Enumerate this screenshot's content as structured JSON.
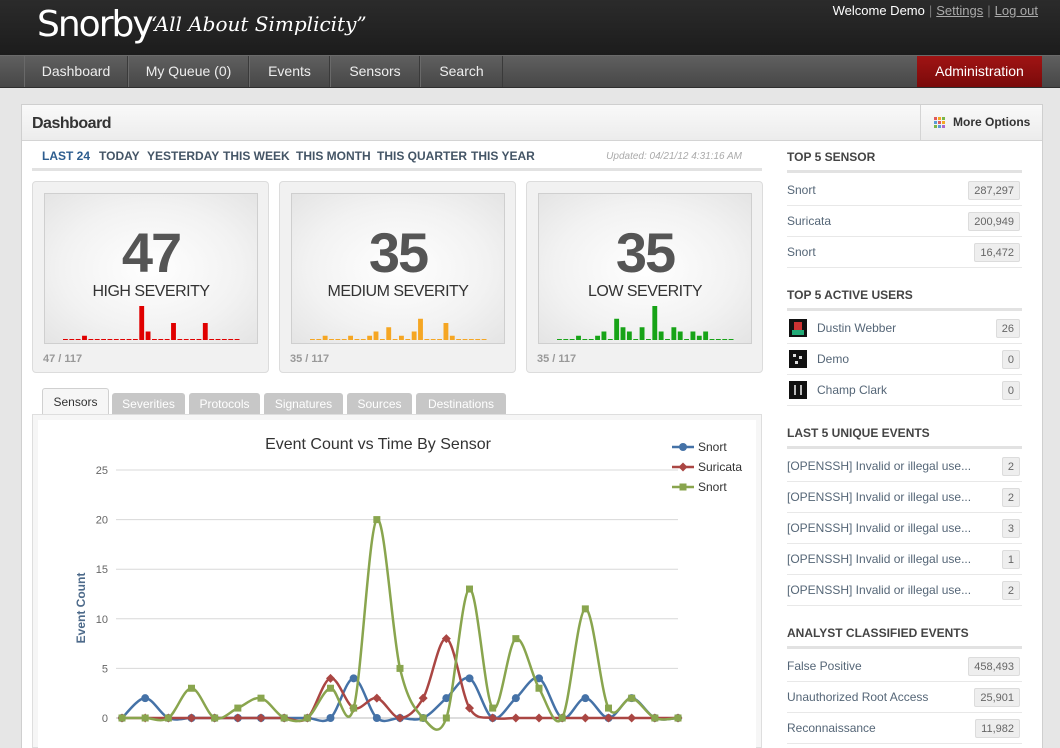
{
  "header": {
    "logo": "Snorby",
    "tagline": "“All About Simplicity”",
    "welcome": "Welcome Demo",
    "settings_link": "Settings",
    "logout_link": "Log out"
  },
  "nav": {
    "items": [
      "Dashboard",
      "My Queue (0)",
      "Events",
      "Sensors",
      "Search"
    ],
    "admin": "Administration"
  },
  "panel": {
    "title": "Dashboard",
    "more_options": "More Options"
  },
  "time_filters": [
    "LAST 24",
    "TODAY",
    "YESTERDAY",
    "THIS WEEK",
    "THIS MONTH",
    "THIS QUARTER",
    "THIS YEAR"
  ],
  "updated": "Updated: 04/21/12 4:31:16 AM",
  "severity": [
    {
      "count": "47",
      "label": "HIGH SEVERITY",
      "footer": "47 / 117",
      "color": "#e00000",
      "bars": [
        0,
        0,
        0,
        1,
        0,
        0,
        0,
        0,
        0,
        0,
        0,
        0,
        8,
        2,
        0,
        0,
        0,
        4,
        0,
        0,
        0,
        0,
        4,
        0,
        0,
        0,
        0,
        0
      ]
    },
    {
      "count": "35",
      "label": "MEDIUM SEVERITY",
      "footer": "35 / 117",
      "color": "#f5a623",
      "bars": [
        0,
        0,
        1,
        0,
        0,
        0,
        1,
        0,
        0,
        1,
        2,
        0,
        3,
        0,
        1,
        0,
        2,
        5,
        0,
        0,
        0,
        4,
        1,
        0,
        0,
        0,
        0,
        0
      ]
    },
    {
      "count": "35",
      "label": "LOW SEVERITY",
      "footer": "35 / 117",
      "color": "#17a317",
      "bars": [
        0,
        0,
        0,
        1,
        0,
        0,
        1,
        2,
        0,
        5,
        3,
        2,
        0,
        3,
        0,
        8,
        2,
        0,
        3,
        2,
        0,
        2,
        1,
        2,
        0,
        0,
        0,
        0
      ]
    }
  ],
  "tabs": [
    "Sensors",
    "Severities",
    "Protocols",
    "Signatures",
    "Sources",
    "Destinations"
  ],
  "sidebar": {
    "top_sensor_title": "TOP 5 SENSOR",
    "top_sensors": [
      {
        "name": "Snort",
        "count": "287,297"
      },
      {
        "name": "Suricata",
        "count": "200,949"
      },
      {
        "name": "Snort",
        "count": "16,472"
      }
    ],
    "active_users_title": "TOP 5 ACTIVE USERS",
    "active_users": [
      {
        "name": "Dustin Webber",
        "count": "26"
      },
      {
        "name": "Demo",
        "count": "0"
      },
      {
        "name": "Champ Clark",
        "count": "0"
      }
    ],
    "unique_events_title": "LAST 5 UNIQUE EVENTS",
    "unique_events": [
      {
        "name": "[OPENSSH] Invalid or illegal use...",
        "count": "2"
      },
      {
        "name": "[OPENSSH] Invalid or illegal use...",
        "count": "2"
      },
      {
        "name": "[OPENSSH] Invalid or illegal use...",
        "count": "3"
      },
      {
        "name": "[OPENSSH] Invalid or illegal use...",
        "count": "1"
      },
      {
        "name": "[OPENSSH] Invalid or illegal use...",
        "count": "2"
      }
    ],
    "classified_title": "ANALYST CLASSIFIED EVENTS",
    "classified": [
      {
        "name": "False Positive",
        "count": "458,493"
      },
      {
        "name": "Unauthorized Root Access",
        "count": "25,901"
      },
      {
        "name": "Reconnaissance",
        "count": "11,982"
      }
    ]
  },
  "chart_data": {
    "type": "line",
    "title": "Event Count vs Time By Sensor",
    "ylabel": "Event Count",
    "xlabel": "",
    "ylim": [
      0,
      25
    ],
    "yticks": [
      0,
      5,
      10,
      15,
      20,
      25
    ],
    "grid": true,
    "legend": "top-right",
    "series": [
      {
        "name": "Snort",
        "color": "#4572a7",
        "marker": "circle",
        "values": [
          0,
          2,
          0,
          0,
          0,
          0,
          0,
          0,
          0,
          0,
          4,
          0,
          0,
          0,
          2,
          4,
          0,
          2,
          4,
          0,
          2,
          0,
          2,
          0,
          0
        ]
      },
      {
        "name": "Suricata",
        "color": "#aa4643",
        "marker": "diamond",
        "values": [
          0,
          0,
          0,
          0,
          0,
          0,
          0,
          0,
          0,
          4,
          1,
          2,
          0,
          2,
          8,
          1,
          0,
          0,
          0,
          0,
          0,
          0,
          0,
          0,
          0
        ]
      },
      {
        "name": "Snort",
        "color": "#89a54e",
        "marker": "square",
        "values": [
          0,
          0,
          0,
          3,
          0,
          1,
          2,
          0,
          0,
          3,
          1,
          20,
          5,
          0,
          0,
          13,
          1,
          8,
          3,
          0,
          11,
          1,
          2,
          0,
          0
        ]
      }
    ]
  }
}
